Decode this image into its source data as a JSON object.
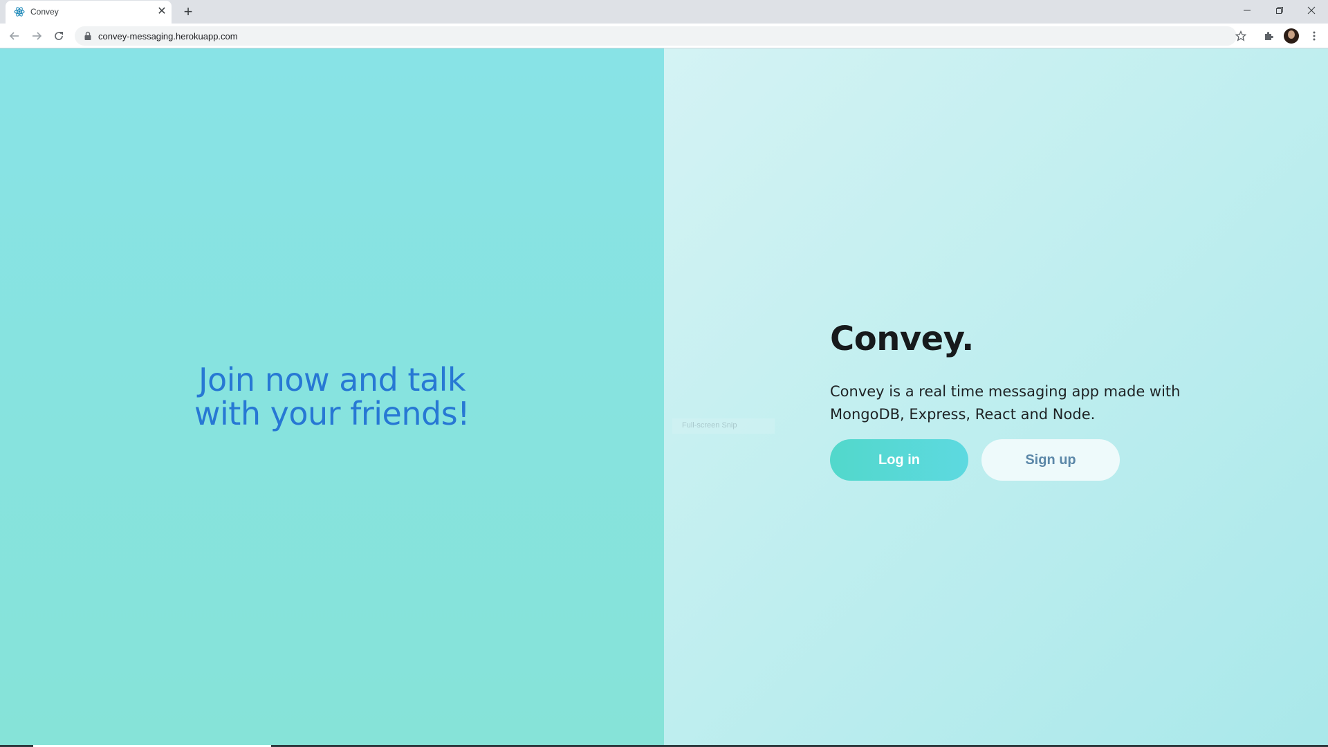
{
  "browser": {
    "tab_title": "Convey",
    "url": "convey-messaging.herokuapp.com"
  },
  "left": {
    "tagline_line1": "Join now and talk",
    "tagline_line2": "with your friends!"
  },
  "right": {
    "brand": "Convey.",
    "description": "Convey is a real time messaging app made with MongoDB, Express, React and Node.",
    "login_label": "Log in",
    "signup_label": "Sign up",
    "snip_label": "Full-screen Snip"
  },
  "colors": {
    "tagline": "#2778d4",
    "login_button": "#52d8cb",
    "signup_text": "#5b87a8"
  },
  "icons": {
    "favicon": "react-icon",
    "back": "arrow-left-icon",
    "forward": "arrow-right-icon",
    "reload": "reload-icon",
    "lock": "lock-icon",
    "star": "star-icon",
    "extensions": "puzzle-icon",
    "menu": "kebab-menu-icon"
  }
}
